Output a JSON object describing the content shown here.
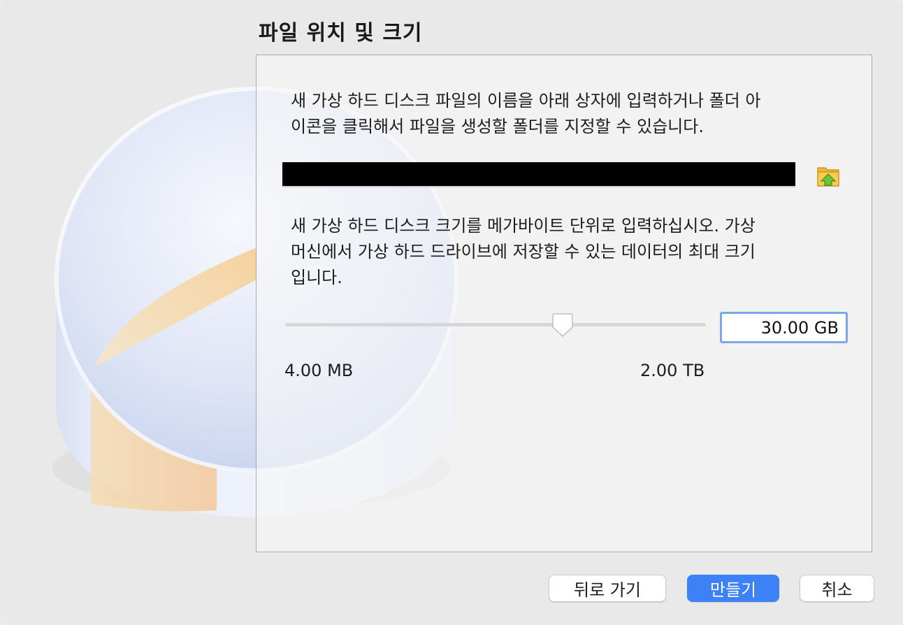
{
  "dialog": {
    "title": "파일 위치 및 크기",
    "location_description": "새 가상 하드 디스크 파일의 이름을 아래 상자에 입력하거나 폴더 아\n이콘을 클릭해서 파일을 생성할 폴더를 지정할 수 있습니다.",
    "file_path_value": "",
    "size_description": "새 가상 하드 디스크 크기를 메가바이트 단위로 입력하십시오. 가상\n머신에서 가상 하드 드라이브에 저장할 수 있는 데이터의 최대 크기\n입니다.",
    "size_value": "30.00 GB",
    "size_min_label": "4.00 MB",
    "size_max_label": "2.00 TB",
    "slider_position_fraction": 0.66
  },
  "buttons": {
    "back_label": "뒤로 가기",
    "create_label": "만들기",
    "cancel_label": "취소"
  },
  "icons": {
    "folder": "folder-up-icon",
    "illustration": "hard-disk-illustration"
  },
  "colors": {
    "accent": "#3c82f6",
    "focus_ring": "#7aa7e8",
    "field_redacted": "#000000"
  }
}
